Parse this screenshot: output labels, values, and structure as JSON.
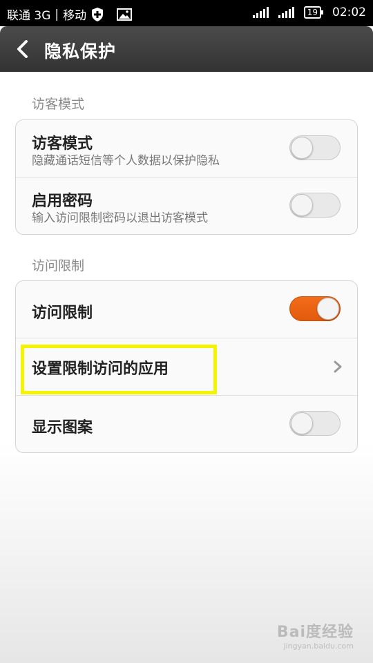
{
  "status_bar": {
    "carrier_left": "联通 3G",
    "separator": "|",
    "carrier_right": "移动",
    "battery": "19",
    "time": "02:02"
  },
  "header": {
    "title": "隐私保护"
  },
  "sections": [
    {
      "label": "访客模式",
      "rows": [
        {
          "title": "访客模式",
          "subtitle": "隐藏通话短信等个人数据以保护隐私",
          "toggle": false
        },
        {
          "title": "启用密码",
          "subtitle": "输入访问限制密码以退出访客模式",
          "toggle": false
        }
      ]
    },
    {
      "label": "访问限制",
      "rows": [
        {
          "title": "访问限制",
          "toggle": true
        },
        {
          "title": "设置限制访问的应用"
        },
        {
          "title": "显示图案",
          "toggle": false
        }
      ]
    }
  ],
  "watermark": {
    "main": "Bai度经验",
    "sub": "jingyan.baidu.com"
  },
  "colors": {
    "accent": "#f26d1b",
    "highlight": "#f4f400"
  }
}
